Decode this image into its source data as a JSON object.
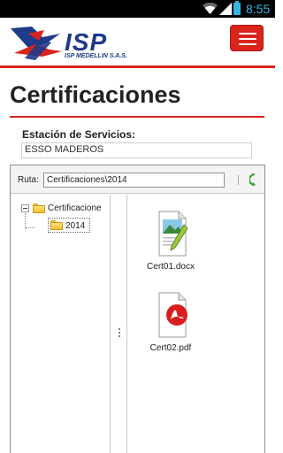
{
  "status_bar": {
    "time": "8:55"
  },
  "header": {
    "logo_text": "ISP",
    "logo_subtitle": "ISP MEDELLIN S.A.S.",
    "accent_color": "#d9241c",
    "brand_color": "#1e3a8a"
  },
  "page": {
    "title": "Certificaciones"
  },
  "station": {
    "label": "Estación de Servicios:",
    "value": "ESSO MADEROS"
  },
  "explorer": {
    "ruta_label": "Ruta:",
    "path_value": "Certificaciones\\2014",
    "tree": {
      "root_label": "Certificacione",
      "child_label": "2014"
    },
    "files": [
      {
        "name": "Cert01.docx",
        "icon": "docx-file-icon"
      },
      {
        "name": "Cert02.pdf",
        "icon": "pdf-file-icon"
      }
    ]
  }
}
